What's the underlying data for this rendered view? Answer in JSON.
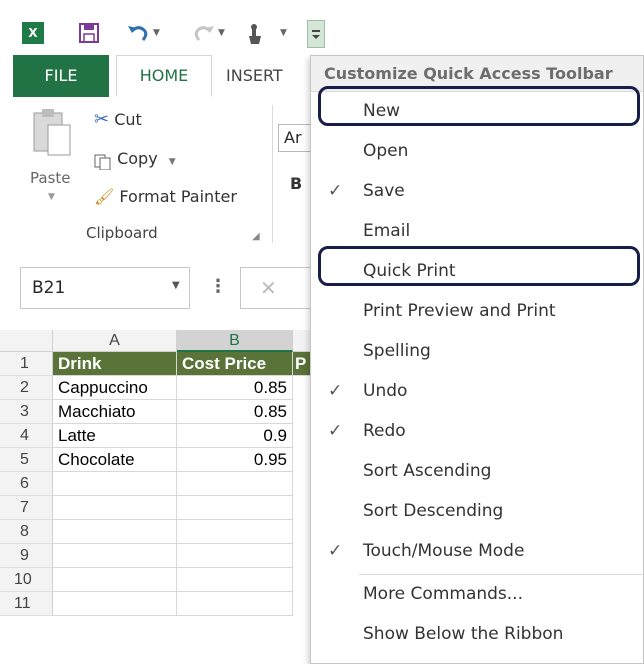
{
  "qat": {
    "app_logo": "X",
    "icons": [
      "excel-logo-icon",
      "save-icon",
      "undo-icon",
      "redo-icon",
      "touch-mode-icon",
      "customize-qat-icon"
    ]
  },
  "tabs": {
    "file": "FILE",
    "home": "HOME",
    "insert": "INSERT"
  },
  "ribbon": {
    "paste": "Paste",
    "cut": "Cut",
    "copy": "Copy",
    "format_painter": "Format Painter",
    "clipboard_group": "Clipboard",
    "font_box": "Ar",
    "bold": "B"
  },
  "formula_bar": {
    "name_box": "B21",
    "dots": "⋮",
    "cancel": "✕"
  },
  "grid": {
    "columns": [
      "A",
      "B"
    ],
    "rows": [
      "1",
      "2",
      "3",
      "4",
      "5",
      "6",
      "7",
      "8",
      "9",
      "10",
      "11"
    ],
    "header": [
      "Drink",
      "Cost Price",
      "P"
    ],
    "data": [
      [
        "Cappuccino",
        "0.85"
      ],
      [
        "Macchiato",
        "0.85"
      ],
      [
        "Latte",
        "0.9"
      ],
      [
        "Chocolate",
        "0.95"
      ]
    ]
  },
  "menu": {
    "title": "Customize Quick Access Toolbar",
    "items": [
      {
        "label": "New",
        "checked": false
      },
      {
        "label": "Open",
        "checked": false
      },
      {
        "label": "Save",
        "checked": true
      },
      {
        "label": "Email",
        "checked": false
      },
      {
        "label": "Quick Print",
        "checked": false
      },
      {
        "label": "Print Preview and Print",
        "checked": false
      },
      {
        "label": "Spelling",
        "checked": false
      },
      {
        "label": "Undo",
        "checked": true
      },
      {
        "label": "Redo",
        "checked": true
      },
      {
        "label": "Sort Ascending",
        "checked": false
      },
      {
        "label": "Sort Descending",
        "checked": false
      },
      {
        "label": "Touch/Mouse Mode",
        "checked": true
      }
    ],
    "more_commands": "More Commands...",
    "show_below": "Show Below the Ribbon",
    "check_glyph": "✓"
  },
  "colors": {
    "excel_green": "#217346",
    "header_fill": "#5a7338",
    "highlight_outline": "#171e4a"
  }
}
